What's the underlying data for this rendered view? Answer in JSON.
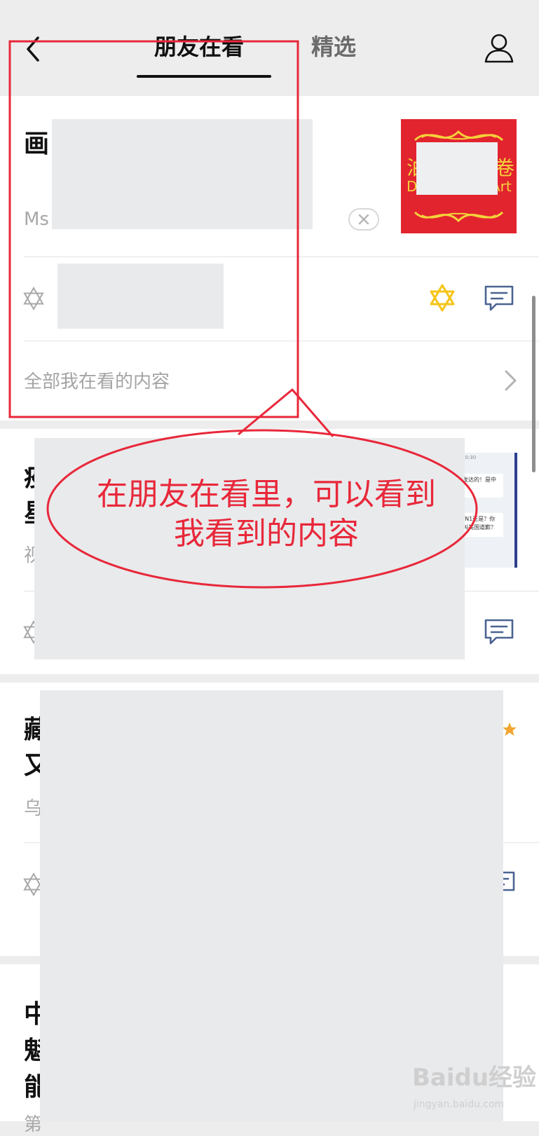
{
  "header": {
    "tabs": [
      {
        "label": "朋友在看",
        "active": true
      },
      {
        "label": "精选",
        "active": false
      }
    ]
  },
  "card1": {
    "title_fragment": "画",
    "source_fragment": "Ms",
    "thumbnail": {
      "left_char": "泊",
      "right_char": "卷",
      "left_text": "D",
      "right_text": "Art"
    },
    "see_all_label": "全部我在看的内容"
  },
  "card2": {
    "title_fragments": [
      "疫",
      "星"
    ],
    "source_fragment": "视",
    "thumb_lines": [
      "午10:30",
      "是发达的！是中",
      "界！",
      "H1N1还是？你",
      "要叫美国道歉？"
    ]
  },
  "card3": {
    "title_fragments": [
      "藏",
      "又"
    ],
    "source_fragment": "乌"
  },
  "card4": {
    "title_fragments": [
      "中",
      "魁",
      "能"
    ],
    "source_fragment": "第"
  },
  "callout": {
    "line1": "在朋友在看里，可以看到",
    "line2": "我看到的内容"
  },
  "watermark": {
    "text": "Baidu经验",
    "sub": "jingyan.baidu.com"
  },
  "colors": {
    "annotation_red": "#e8283a",
    "mask_gray": "#e9eaec",
    "wow_icon_yellow": "#f5c518",
    "comment_icon_blue": "#4a6391"
  }
}
